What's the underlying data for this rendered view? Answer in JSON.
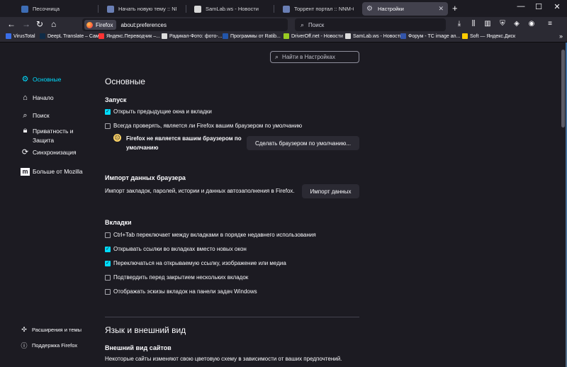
{
  "tabs": [
    {
      "title": "Песочница",
      "color": "#3d6db5",
      "active": false
    },
    {
      "title": "Начать новую тему :: NNM-C",
      "color": "#6a7fb5",
      "active": false
    },
    {
      "title": "SamLab.ws - Новости",
      "color": "#d8d8d8",
      "active": false
    },
    {
      "title": "Торрент портал :: NNM-Club",
      "color": "#6a7fb5",
      "active": false
    },
    {
      "title": "Настройки",
      "color": "#cfcfd8",
      "active": true
    }
  ],
  "tab_close": "✕",
  "newtab": "+",
  "window": {
    "minimize": "—",
    "maximize": "☐",
    "close": "✕"
  },
  "toolbar": {
    "back": "←",
    "forward": "→",
    "reload": "↻",
    "home": "⌂",
    "identity_label": "Firefox",
    "url": "about:preferences",
    "search_placeholder": "Поиск",
    "icons": [
      "download-icon",
      "library-icon",
      "sidebar-icon",
      "shield-icon",
      "extension-icon",
      "account-icon",
      "menu-icon"
    ]
  },
  "bookmarks": [
    {
      "label": "VirusTotal",
      "color": "#3a6ee8"
    },
    {
      "label": "DeepL Translate – Сам...",
      "color": "#0f2b46"
    },
    {
      "label": "Яндекс.Переводчик –...",
      "color": "#ff3333"
    },
    {
      "label": "Радикал-Фото: фото-...",
      "color": "#dddddd"
    },
    {
      "label": "Программы от Ratib...",
      "color": "#2255aa"
    },
    {
      "label": "DriverOff.net - Новости",
      "color": "#99cc22"
    },
    {
      "label": "SamLab.ws - Новости",
      "color": "#dddddd"
    },
    {
      "label": "Форум - TC image an...",
      "color": "#3355aa"
    },
    {
      "label": "Soft — Яндекс.Диск",
      "color": "#ffcc00"
    }
  ],
  "bookmarks_more": "»",
  "prefs_search_placeholder": "Найти в Настройках",
  "sidebar": {
    "categories": [
      {
        "label": "Основные",
        "icon": "gear-icon"
      },
      {
        "label": "Начало",
        "icon": "home-icon"
      },
      {
        "label": "Поиск",
        "icon": "search-icon"
      },
      {
        "label": "Приватность и Защита",
        "icon": "lock-icon"
      },
      {
        "label": "Синхронизация",
        "icon": "sync-icon"
      },
      {
        "label": "Больше от Mozilla",
        "icon": "mozilla-icon"
      }
    ],
    "bottom": [
      {
        "label": "Расширения и темы",
        "icon": "puzzle-icon"
      },
      {
        "label": "Поддержка Firefox",
        "icon": "help-icon"
      }
    ]
  },
  "main": {
    "title": "Основные",
    "startup": {
      "heading": "Запуск",
      "restore_session": "Открыть предыдущие окна и вкладки",
      "check_default": "Всегда проверять, является ли Firefox вашим браузером по умолчанию",
      "not_default": "Firefox не является вашим браузером по умолчанию",
      "make_default_button": "Сделать браузером по умолчанию..."
    },
    "import": {
      "heading": "Импорт данных браузера",
      "description": "Импорт закладок, паролей, истории и данных автозаполнения в Firefox.",
      "button": "Импорт данных"
    },
    "tabs": {
      "heading": "Вкладки",
      "options": [
        {
          "label": "Ctrl+Tab переключает между вкладками в порядке недавнего использования",
          "checked": false
        },
        {
          "label": "Открывать ссылки во вкладках вместо новых окон",
          "checked": true
        },
        {
          "label": "Переключаться на открываемую ссылку, изображение или медиа",
          "checked": true
        },
        {
          "label": "Подтвердить перед закрытием нескольких вкладок",
          "checked": false
        },
        {
          "label": "Отображать эскизы вкладок на панели задач Windows",
          "checked": false
        }
      ]
    },
    "language": {
      "title": "Язык и внешний вид",
      "appearance_heading": "Внешний вид сайтов",
      "appearance_desc": "Некоторые сайты изменяют свою цветовую схему в зависимости от ваших предпочтений."
    }
  }
}
